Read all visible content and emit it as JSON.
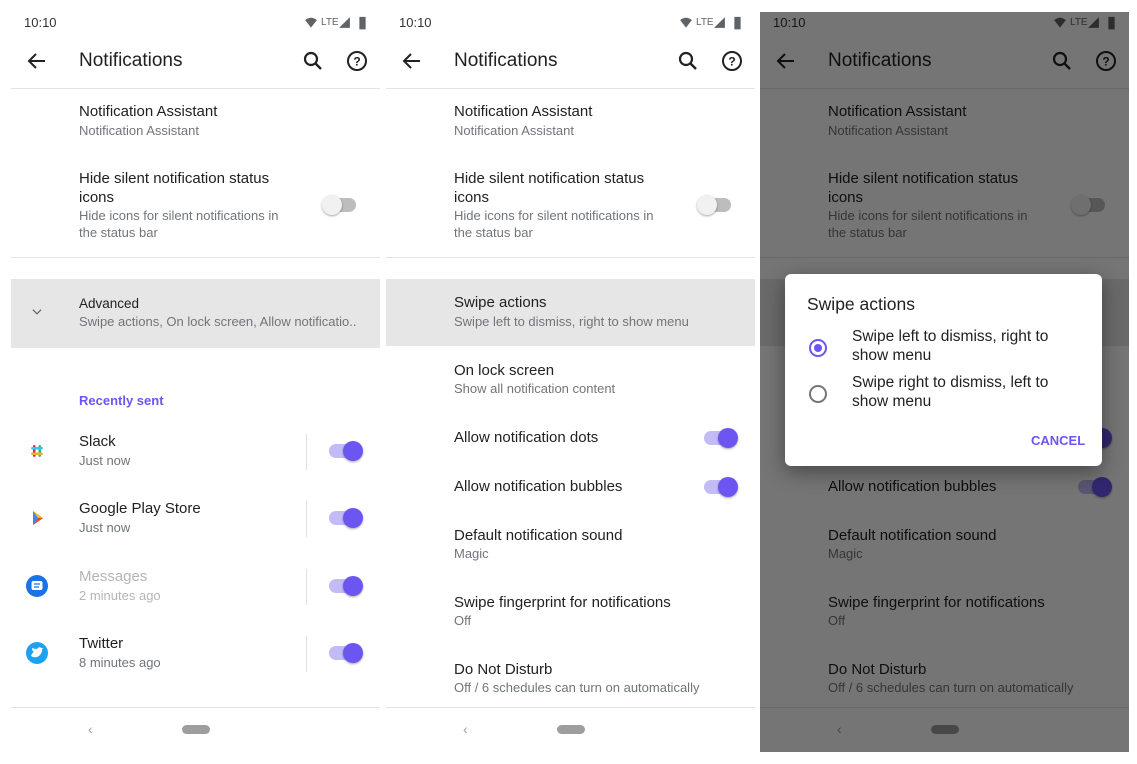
{
  "colors": {
    "accent": "#6b56f2",
    "overlay": "rgba(0,0,0,0.54)"
  },
  "status": {
    "time": "10:10",
    "network": "LTE",
    "icons": [
      "wifi-icon",
      "signal-icon",
      "battery-icon"
    ]
  },
  "toolbar": {
    "title": "Notifications",
    "back_icon": "arrow-left-icon",
    "search_icon": "search-icon",
    "help_icon": "help-circle-icon"
  },
  "common": {
    "assistant": {
      "title": "Notification Assistant",
      "subtitle": "Notification Assistant"
    },
    "hide_silent": {
      "title_line1": "Hide silent notification status",
      "title_line2": "icons",
      "sub_line1": "Hide icons for silent notifications in",
      "sub_line2": "the status bar",
      "enabled": false
    }
  },
  "screen1": {
    "advanced": {
      "title": "Advanced",
      "subtitle": "Swipe actions, On lock screen, Allow notificatio.."
    },
    "recently_sent": "Recently sent",
    "apps": [
      {
        "name": "Slack",
        "time": "Just now",
        "enabled": true,
        "icon": "slack-icon",
        "dimmed": false
      },
      {
        "name": "Google Play Store",
        "time": "Just now",
        "enabled": true,
        "icon": "play-store-icon",
        "dimmed": false
      },
      {
        "name": "Messages",
        "time": "2 minutes ago",
        "enabled": true,
        "icon": "messages-icon",
        "dimmed": true
      },
      {
        "name": "Twitter",
        "time": "8 minutes ago",
        "enabled": true,
        "icon": "twitter-icon",
        "dimmed": false
      }
    ]
  },
  "screen2": {
    "items": [
      {
        "title": "Swipe actions",
        "subtitle": "Swipe left to dismiss, right to show menu"
      },
      {
        "title": "On lock screen",
        "subtitle": "Show all notification content"
      },
      {
        "title": "Allow notification dots",
        "toggle": true
      },
      {
        "title": "Allow notification bubbles",
        "toggle": true
      },
      {
        "title": "Default notification sound",
        "subtitle": "Magic"
      },
      {
        "title": "Swipe fingerprint for notifications",
        "subtitle": "Off"
      },
      {
        "title": "Do Not Disturb",
        "subtitle": "Off / 6 schedules can turn on automatically"
      }
    ]
  },
  "dialog": {
    "title": "Swipe actions",
    "options": [
      {
        "line1": "Swipe left to dismiss, right to",
        "line2": "show menu",
        "selected": true
      },
      {
        "line1": "Swipe right to dismiss, left to",
        "line2": "show menu",
        "selected": false
      }
    ],
    "cancel": "CANCEL"
  }
}
